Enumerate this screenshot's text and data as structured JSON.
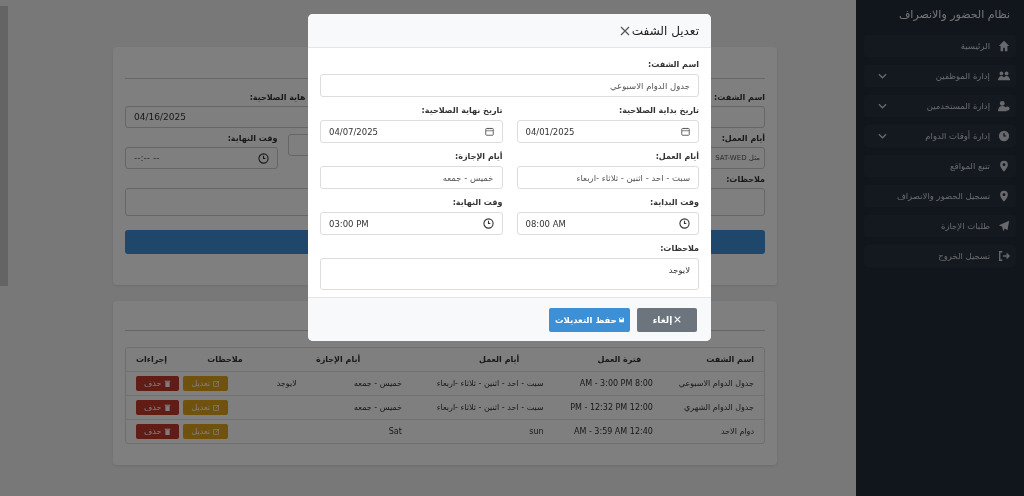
{
  "sidebar": {
    "title": "نظام الحضور والانصراف",
    "items": [
      {
        "label": "الرئيسية",
        "kind": "link"
      },
      {
        "label": "إدارة الموظفين",
        "kind": "group"
      },
      {
        "label": "إدارة المستخدمين",
        "kind": "group"
      },
      {
        "label": "إدارة أوقات الدوام",
        "kind": "group"
      },
      {
        "label": "تتبع المواقع",
        "kind": "link"
      },
      {
        "label": "تسجيل الحضور والانصراف",
        "kind": "link"
      },
      {
        "label": "طلبات الإجازة",
        "kind": "link"
      },
      {
        "label": "تسجيل الخروج",
        "kind": "link"
      }
    ]
  },
  "background_form": {
    "name_label": "اسم الشفت:",
    "end_date_label": "هاية الصلاحية:",
    "end_date_value": "04/16/2025",
    "work_days_label": "أيام العمل:",
    "work_days_placeholder": "مثل SAT-WED",
    "end_time_label": "وقت النهاية:",
    "end_time_value": "--:-- --",
    "notes_label": "ملاحظات:"
  },
  "table": {
    "columns": [
      "اسم الشفت",
      "فترة العمل",
      "أيام العمل",
      "أيام الإجازة",
      "ملاحظات",
      "إجراءات"
    ],
    "rows": [
      {
        "cells": [
          "جدول الدوام الاسبوعي",
          "8:00 AM - 3:00 PM",
          "سبت - احد - اثنين - ثلاثاء -اربعاء",
          "خميس - جمعه",
          "لايوجد"
        ],
        "actions": [
          {
            "label": "تعديل",
            "kind": "edit"
          },
          {
            "label": "حذف",
            "kind": "delete"
          }
        ]
      },
      {
        "cells": [
          "جدول الدوام الشهري",
          "12:00 PM - 12:32 PM",
          "سبت - احد - اثنين - ثلاثاء -اربعاء",
          "خميس - جمعه",
          ""
        ],
        "actions": [
          {
            "label": "تعديل",
            "kind": "edit"
          },
          {
            "label": "حذف",
            "kind": "delete"
          }
        ]
      },
      {
        "cells": [
          "دوام الاحد",
          "12:40 AM - 3:59 AM",
          "sun",
          "Sat",
          ""
        ],
        "actions": [
          {
            "label": "تعديل",
            "kind": "edit"
          },
          {
            "label": "حذف",
            "kind": "delete"
          }
        ]
      }
    ]
  },
  "modal": {
    "title": "تعديل الشفت",
    "fields": [
      {
        "label": "اسم الشفت:",
        "value": "جدول الدوام الاسبوعي",
        "kind": "text",
        "wide": true
      },
      {
        "label": "تاريخ بداية الصلاحية:",
        "value": "04/01/2025",
        "kind": "date",
        "wide": false
      },
      {
        "label": "تاريخ نهاية الصلاحية:",
        "value": "04/07/2025",
        "kind": "date",
        "wide": false
      },
      {
        "label": "أيام العمل:",
        "value": "سبت - احد - اثنين - ثلاثاء -اربعاء",
        "kind": "text",
        "wide": false
      },
      {
        "label": "أيام الإجازة:",
        "value": "خميس - جمعه",
        "kind": "text",
        "wide": false
      },
      {
        "label": "وقت البداية:",
        "value": "08:00 AM",
        "kind": "time",
        "wide": false
      },
      {
        "label": "وقت النهاية:",
        "value": "03:00 PM",
        "kind": "time",
        "wide": false
      },
      {
        "label": "ملاحظات:",
        "value": "لايوجد",
        "kind": "textarea",
        "wide": true
      }
    ],
    "buttons": [
      {
        "label": "إلغاء",
        "kind": "cancel"
      },
      {
        "label": "حفظ التعديلات",
        "kind": "save"
      }
    ]
  }
}
